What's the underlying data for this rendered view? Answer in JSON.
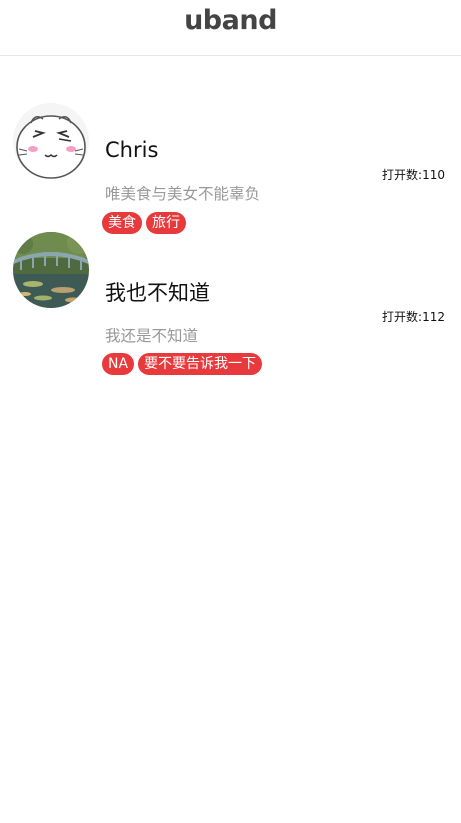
{
  "header": {
    "logo_text": "uband"
  },
  "users": [
    {
      "name": "Chris",
      "description": "唯美食与美女不能辜负",
      "opens": "打开数:110",
      "tags": [
        "美食",
        "旅行"
      ],
      "avatar_icon": "cat-face-avatar"
    },
    {
      "name": "我也不知道",
      "description": "我还是不知道",
      "opens": "打开数:112",
      "tags": [
        "NA",
        "要不要告诉我一下"
      ],
      "avatar_icon": "painting-bridge-avatar"
    }
  ],
  "colors": {
    "tag_background": "#e83a3c",
    "description_text": "#999999",
    "logo": "#444444"
  }
}
